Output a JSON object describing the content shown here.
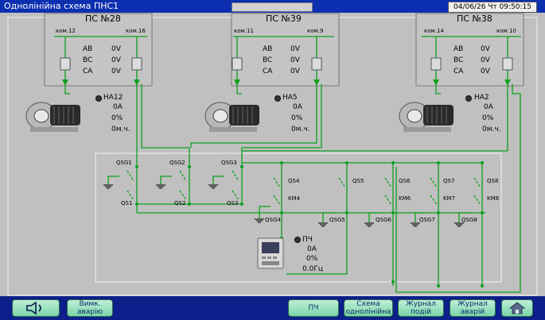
{
  "window": {
    "title": "Однолінійна схема ПНС1",
    "datetime": "04/06/26  Чт  09:50:15"
  },
  "substations": [
    {
      "title": "ПС №28",
      "left_feeder": "ком.12",
      "right_feeder": "ком.16",
      "phases": [
        {
          "name": "AB",
          "value": "0V"
        },
        {
          "name": "BC",
          "value": "0V"
        },
        {
          "name": "CA",
          "value": "0V"
        }
      ]
    },
    {
      "title": "ПС №39",
      "left_feeder": "ком.11",
      "right_feeder": "ком.9",
      "phases": [
        {
          "name": "AB",
          "value": "0V"
        },
        {
          "name": "BC",
          "value": "0V"
        },
        {
          "name": "CA",
          "value": "0V"
        }
      ]
    },
    {
      "title": "ПС №38",
      "left_feeder": "ком.14",
      "right_feeder": "ком.10",
      "phases": [
        {
          "name": "AB",
          "value": "0V"
        },
        {
          "name": "BC",
          "value": "0V"
        },
        {
          "name": "CA",
          "value": "0V"
        }
      ]
    }
  ],
  "pumps": [
    {
      "name": "НА12",
      "current": "0A",
      "load": "0%",
      "hours": "0м.ч."
    },
    {
      "name": "НА5",
      "current": "0A",
      "load": "0%",
      "hours": "0м.ч."
    },
    {
      "name": "НА2",
      "current": "0A",
      "load": "0%",
      "hours": "0м.ч."
    }
  ],
  "switches": {
    "qsg1": "QSG1",
    "qsg2": "QSG2",
    "qsg3": "QSG3",
    "qs1": "QS1",
    "qs2": "QS2",
    "qs3": "QS3",
    "qs4": "QS4",
    "km4": "KM4",
    "qsg4": "QSG4",
    "qs5": "QS5",
    "qsg5": "QSG5",
    "qs6": "QS6",
    "km6": "KM6",
    "qsg6": "QSG6",
    "qs7": "QS7",
    "km7": "KM7",
    "qsg7": "QSG7",
    "qs8": "QS8",
    "km8": "KM8",
    "qsg8": "QSG8"
  },
  "vfd": {
    "name": "ПЧ",
    "current": "0A",
    "load": "0%",
    "frequency": "0.0Гц"
  },
  "toolbar": {
    "sound_icon": "speaker-icon",
    "mute_line1": "Вимк.",
    "mute_line2": "аварію",
    "pch": "ПЧ",
    "scheme_line1": "Схема",
    "scheme_line2": "однолінійна",
    "events_line1": "Журнал",
    "events_line2": "подій",
    "alarms_line1": "Журнал",
    "alarms_line2": "аварій",
    "home_icon": "home-icon"
  },
  "colors": {
    "line": "#0aa01e",
    "title_bar": "#0c2fb0",
    "background": "#c0c0c0",
    "button": "#9fe4c2"
  }
}
